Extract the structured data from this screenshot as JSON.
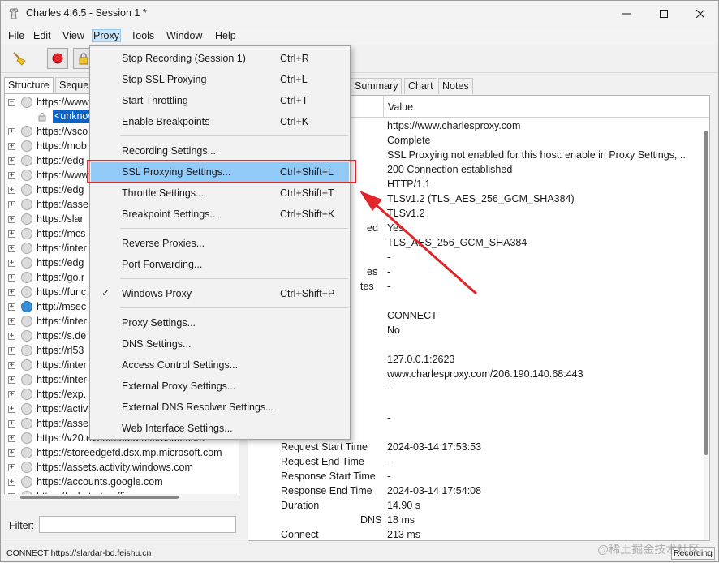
{
  "window": {
    "title": "Charles 4.6.5 - Session 1 *",
    "min_glyph": "—",
    "max_glyph": "☐",
    "close_glyph": "✕"
  },
  "menubar": {
    "file": "File",
    "edit": "Edit",
    "view": "View",
    "proxy": "Proxy",
    "tools": "Tools",
    "window": "Window",
    "help": "Help"
  },
  "toolbar": {
    "icons": [
      "broom-icon",
      "record-icon",
      "ssl-lock-icon"
    ]
  },
  "left": {
    "tab_structure": "Structure",
    "tab_sequence": "Seque",
    "tree": [
      {
        "exp": "−",
        "url": "https://www",
        "ws": false
      },
      {
        "exp": "+",
        "url": "https://vsco",
        "ws": false
      },
      {
        "exp": "+",
        "url": "https://mob",
        "ws": false
      },
      {
        "exp": "+",
        "url": "https://edg",
        "ws": false
      },
      {
        "exp": "+",
        "url": "https://www",
        "ws": false
      },
      {
        "exp": "+",
        "url": "https://edg",
        "ws": false
      },
      {
        "exp": "+",
        "url": "https://asse",
        "ws": false
      },
      {
        "exp": "+",
        "url": "https://slar",
        "ws": false
      },
      {
        "exp": "+",
        "url": "https://mcs",
        "ws": false
      },
      {
        "exp": "+",
        "url": "https://inter",
        "ws": false
      },
      {
        "exp": "+",
        "url": "https://edg",
        "ws": false
      },
      {
        "exp": "+",
        "url": "https://go.r",
        "ws": false
      },
      {
        "exp": "+",
        "url": "https://func",
        "ws": false
      },
      {
        "exp": "+",
        "url": "http://msec",
        "ws": true
      },
      {
        "exp": "+",
        "url": "https://inter",
        "ws": false
      },
      {
        "exp": "+",
        "url": "https://s.de",
        "ws": false
      },
      {
        "exp": "+",
        "url": "https://rl53",
        "ws": false
      },
      {
        "exp": "+",
        "url": "https://inter",
        "ws": false
      },
      {
        "exp": "+",
        "url": "https://inter",
        "ws": false
      },
      {
        "exp": "+",
        "url": "https://exp.",
        "ws": false
      },
      {
        "exp": "+",
        "url": "https://activ",
        "ws": false
      },
      {
        "exp": "+",
        "url": "https://asse",
        "ws": false
      },
      {
        "exp": "+",
        "url": "https://v20.events.data.microsoft.com",
        "ws": false
      },
      {
        "exp": "+",
        "url": "https://storeedgefd.dsx.mp.microsoft.com",
        "ws": false
      },
      {
        "exp": "+",
        "url": "https://assets.activity.windows.com",
        "ws": false
      },
      {
        "exp": "+",
        "url": "https://accounts.google.com",
        "ws": false
      },
      {
        "exp": "+",
        "url": "https://substrate.office.com",
        "ws": false
      }
    ],
    "child_selected": "<unknown>",
    "filter_label": "Filter:"
  },
  "right": {
    "tabs": [
      "Summary",
      "Chart",
      "Notes"
    ],
    "value_header": "Value",
    "rows": [
      {
        "label": "",
        "value": "https://www.charlesproxy.com"
      },
      {
        "label": "",
        "value": "Complete"
      },
      {
        "label": "",
        "value": "SSL Proxying not enabled for this host: enable in Proxy Settings, ..."
      },
      {
        "label": "",
        "value": "200 Connection established"
      },
      {
        "label": "",
        "value": "HTTP/1.1"
      },
      {
        "label": "",
        "value": "TLSv1.2 (TLS_AES_256_GCM_SHA384)"
      },
      {
        "label": "",
        "value": "TLSv1.2"
      },
      {
        "label": "ed",
        "value": "Yes"
      },
      {
        "label": "",
        "value": "TLS_AES_256_GCM_SHA384"
      },
      {
        "label": "",
        "value": "-"
      },
      {
        "label": "es",
        "value": "-"
      },
      {
        "label": "tes",
        "value": "-"
      },
      {
        "label": "",
        "value": ""
      },
      {
        "label": "",
        "value": "CONNECT"
      },
      {
        "label": "",
        "value": "No"
      },
      {
        "label": "",
        "value": ""
      },
      {
        "label": "",
        "value": "127.0.0.1:2623"
      },
      {
        "label": "",
        "value": "www.charlesproxy.com/206.190.140.68:443"
      },
      {
        "label": "",
        "value": "-"
      },
      {
        "label": "",
        "value": ""
      },
      {
        "label": "",
        "value": "-"
      },
      {
        "label": "",
        "value": ""
      },
      {
        "label": "Request Start Time",
        "value": "2024-03-14 17:53:53"
      },
      {
        "label": "Request End Time",
        "value": "-"
      },
      {
        "label": "Response Start Time",
        "value": "-"
      },
      {
        "label": "Response End Time",
        "value": "2024-03-14 17:54:08"
      },
      {
        "label": "Duration",
        "value": "14.90 s"
      },
      {
        "label": "DNS",
        "value": "18 ms"
      },
      {
        "label": "Connect",
        "value": "213 ms"
      }
    ]
  },
  "proxy_menu": {
    "items": [
      {
        "label": "Stop Recording (Session 1)",
        "shortcut": "Ctrl+R"
      },
      {
        "label": "Stop SSL Proxying",
        "shortcut": "Ctrl+L"
      },
      {
        "label": "Start Throttling",
        "shortcut": "Ctrl+T"
      },
      {
        "label": "Enable Breakpoints",
        "shortcut": "Ctrl+K"
      },
      {
        "label": "Recording Settings...",
        "shortcut": ""
      },
      {
        "label": "SSL Proxying Settings...",
        "shortcut": "Ctrl+Shift+L"
      },
      {
        "label": "Throttle Settings...",
        "shortcut": "Ctrl+Shift+T"
      },
      {
        "label": "Breakpoint Settings...",
        "shortcut": "Ctrl+Shift+K"
      },
      {
        "label": "Reverse Proxies...",
        "shortcut": ""
      },
      {
        "label": "Port Forwarding...",
        "shortcut": ""
      },
      {
        "label": "Windows Proxy",
        "shortcut": "Ctrl+Shift+P",
        "check": "✓"
      },
      {
        "label": "Proxy Settings...",
        "shortcut": ""
      },
      {
        "label": "DNS Settings...",
        "shortcut": ""
      },
      {
        "label": "Access Control Settings...",
        "shortcut": ""
      },
      {
        "label": "External Proxy Settings...",
        "shortcut": ""
      },
      {
        "label": "External DNS Resolver Settings...",
        "shortcut": ""
      },
      {
        "label": "Web Interface Settings...",
        "shortcut": ""
      }
    ]
  },
  "statusbar": {
    "text": "CONNECT https://slardar-bd.feishu.cn",
    "recording": "Recording",
    "watermark": "@稀土掘金技术社区"
  },
  "colors": {
    "highlight": "#91c9f7",
    "annotation_red": "#e0262a",
    "selection_blue": "#0a64c8"
  }
}
